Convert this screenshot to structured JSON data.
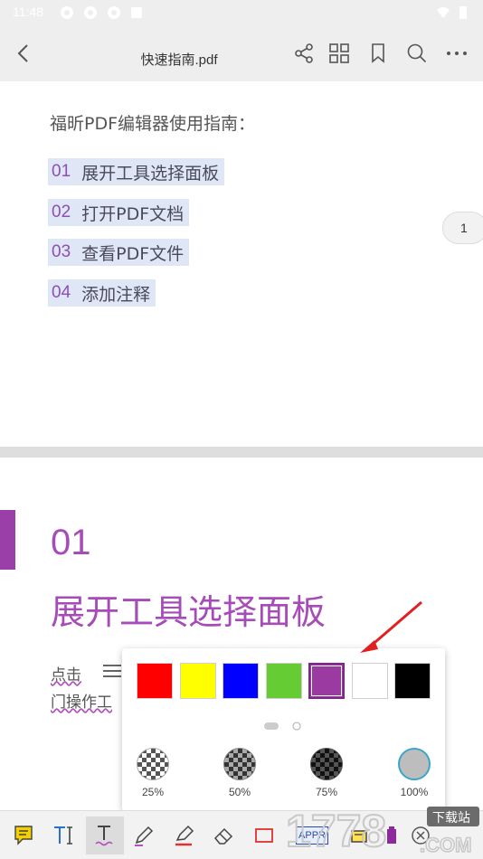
{
  "status_bar": {
    "time": "11:48"
  },
  "app_bar": {
    "title": "快速指南.pdf",
    "icons": [
      "back-icon",
      "share-icon",
      "grid-icon",
      "bookmark-icon",
      "search-icon",
      "more-icon"
    ]
  },
  "page1": {
    "heading": "福昕PDF编辑器使用指南：",
    "toc": [
      {
        "num": "01",
        "text": "展开工具选择面板"
      },
      {
        "num": "02",
        "text": "打开PDF文档"
      },
      {
        "num": "03",
        "text": "查看PDF文件"
      },
      {
        "num": "04",
        "text": "添加注释"
      }
    ],
    "page_badge": "1"
  },
  "page2": {
    "section_num": "01",
    "section_title": "展开工具选择面板",
    "body_line1": "点击",
    "body_line2": "门操作工"
  },
  "color_popup": {
    "colors": [
      "#ff0000",
      "#ffff00",
      "#0000ff",
      "#66cc33",
      "#9b3aa0",
      "#ffffff",
      "#000000"
    ],
    "selected_color": "#9b3aa0",
    "opacity_options": [
      "25%",
      "50%",
      "75%",
      "100%"
    ],
    "selected_opacity": "100%",
    "page_indicator": {
      "pages": 2,
      "current": 1
    }
  },
  "toolbar": {
    "tools": [
      "note-icon",
      "typewriter-icon",
      "text-underline-icon",
      "pencil-icon",
      "highlighter-icon",
      "eraser-icon",
      "rectangle-icon",
      "stamp-icon",
      "textbox-icon",
      "color-icon",
      "close-icon"
    ],
    "active_tool": "text-underline-icon",
    "stamp_label": "APPR"
  },
  "watermark": {
    "text": "1778",
    "sub": "下载站",
    "domain": ".COM"
  }
}
